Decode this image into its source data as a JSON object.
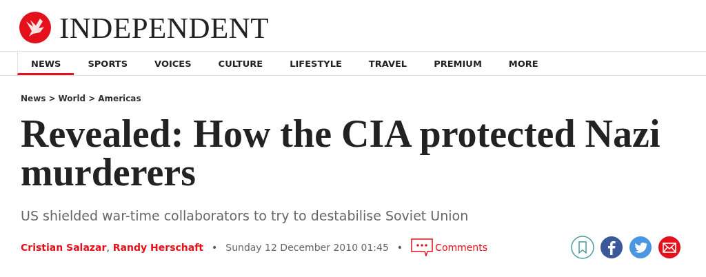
{
  "masthead": {
    "title": "INDEPENDENT"
  },
  "nav": [
    {
      "label": "NEWS",
      "selected": true
    },
    {
      "label": "SPORTS",
      "selected": false
    },
    {
      "label": "VOICES",
      "selected": false
    },
    {
      "label": "CULTURE",
      "selected": false
    },
    {
      "label": "LIFESTYLE",
      "selected": false
    },
    {
      "label": "TRAVEL",
      "selected": false
    },
    {
      "label": "PREMIUM",
      "selected": false
    },
    {
      "label": "MORE",
      "selected": false
    }
  ],
  "breadcrumb": {
    "items": [
      "News",
      "World",
      "Americas"
    ],
    "separator": ">"
  },
  "headline": "Revealed: How the CIA protected Nazi murderers",
  "standfirst": "US shielded war-time collaborators to try to destabilise Soviet Union",
  "byline": {
    "authors": [
      "Cristian Salazar",
      "Randy Herschaft"
    ],
    "author_separator": ",",
    "bullet": "•",
    "date": "Sunday 12 December 2010 01:45",
    "comments": "Comments"
  },
  "share": [
    {
      "kind": "bookmark"
    },
    {
      "kind": "facebook"
    },
    {
      "kind": "twitter"
    },
    {
      "kind": "email"
    }
  ]
}
